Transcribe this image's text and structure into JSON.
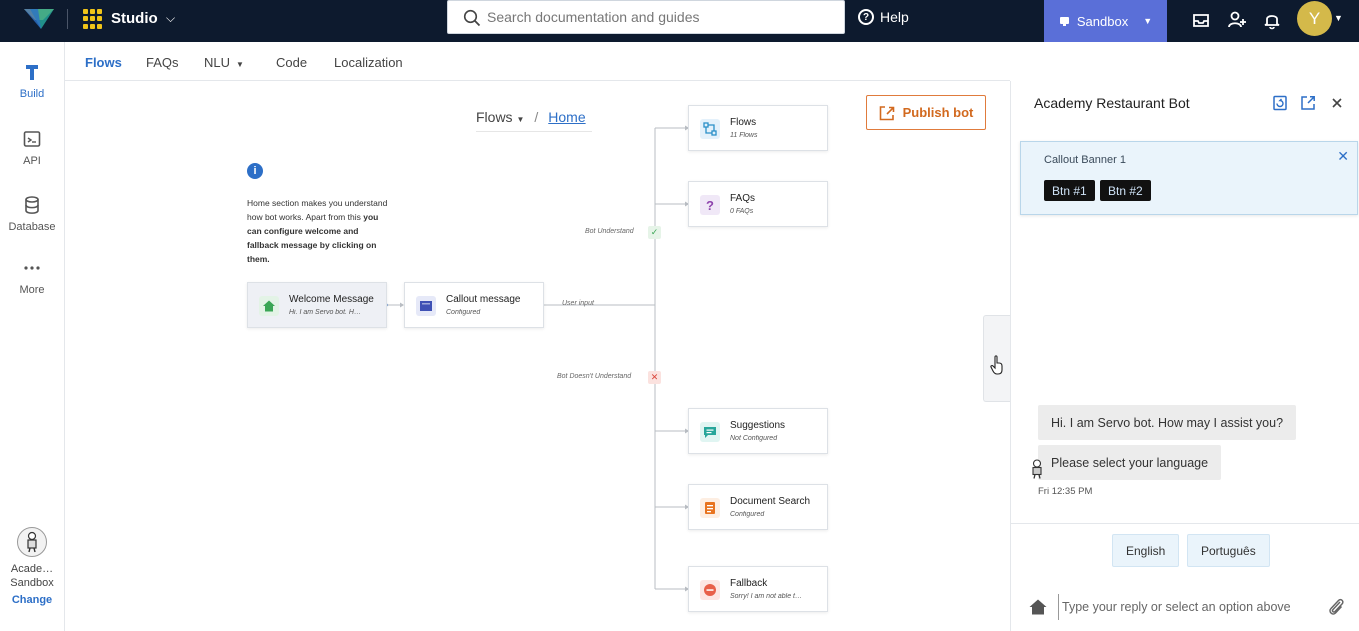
{
  "topbar": {
    "app_name": "Studio",
    "search_placeholder": "Search documentation and guides",
    "help_label": "Help",
    "environment_label": "Sandbox",
    "avatar_initial": "Y"
  },
  "leftnav": {
    "items": [
      {
        "label": "Build",
        "icon": "build-icon"
      },
      {
        "label": "API",
        "icon": "api-icon"
      },
      {
        "label": "Database",
        "icon": "database-icon"
      },
      {
        "label": "More",
        "icon": "more-icon"
      }
    ],
    "org_name": "Acade…",
    "org_env": "Sandbox",
    "change_label": "Change"
  },
  "tabs": [
    {
      "label": "Flows",
      "active": true
    },
    {
      "label": "FAQs"
    },
    {
      "label": "NLU",
      "dropdown": true
    },
    {
      "label": "Code"
    },
    {
      "label": "Localization"
    }
  ],
  "breadcrumb": {
    "root": "Flows",
    "separator": "/",
    "current": "Home"
  },
  "publish_label": "Publish bot",
  "info": {
    "text_plain": "Home section makes you understand how bot works. Apart from this ",
    "text_bold": "you can configure welcome and fallback message by clicking on them."
  },
  "nodes": {
    "welcome": {
      "title": "Welcome Message",
      "sub": "Hi. I am Servo bot. H…"
    },
    "callout": {
      "title": "Callout message",
      "sub": "Configured"
    },
    "flows": {
      "title": "Flows",
      "sub": "11 Flows"
    },
    "faqs": {
      "title": "FAQs",
      "sub": "0 FAQs"
    },
    "suggestions": {
      "title": "Suggestions",
      "sub": "Not Configured"
    },
    "docsearch": {
      "title": "Document Search",
      "sub": "Configured"
    },
    "fallback": {
      "title": "Fallback",
      "sub": "Sorry! I am not able t…"
    }
  },
  "edges": {
    "user_input": "User input",
    "understand": "Bot Understand",
    "not_understand": "Bot Doesn't Understand"
  },
  "chat": {
    "title": "Academy Restaurant Bot",
    "banner_title": "Callout Banner 1",
    "banner_btn1": "Btn #1",
    "banner_btn2": "Btn #2",
    "msg1": "Hi. I am Servo bot. How may I assist you?",
    "msg2": "Please select your language",
    "time": "Fri 12:35 PM",
    "quick1": "English",
    "quick2": "Português",
    "reply_placeholder": "Type your reply or select an option above"
  },
  "colors": {
    "topbar": "#0d1a2e",
    "accent": "#2d6fc7",
    "sandbox": "#5a6fd8",
    "publish": "#d2691e"
  }
}
